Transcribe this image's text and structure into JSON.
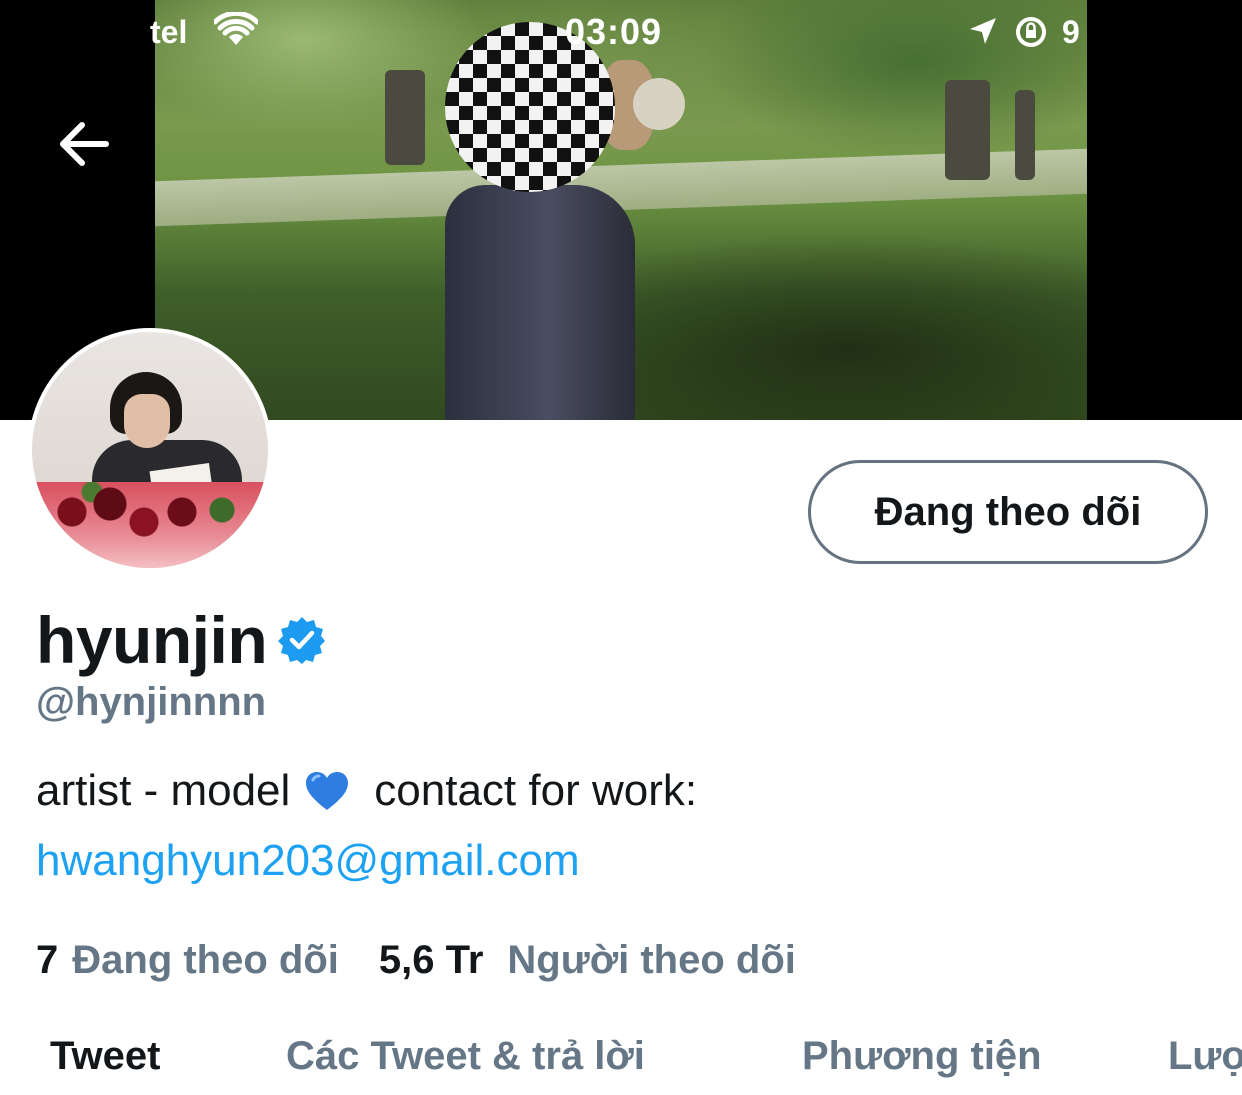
{
  "status_bar": {
    "carrier": "tel",
    "time": "03:09",
    "battery": "9"
  },
  "header": {
    "back_icon": "arrow-left-icon",
    "banner_description_icon": "banner-photo"
  },
  "profile": {
    "display_name": "hyunjin",
    "handle": "@hynjinnnn",
    "verified": true,
    "follow_button_label": "Đang theo dõi",
    "bio_text": "artist - model",
    "bio_emoji": "💙",
    "bio_text_after": "contact for work:",
    "bio_link": "hwanghyun203@gmail.com"
  },
  "stats": {
    "following_count": "7",
    "following_label": "Đang theo dõi",
    "followers_count": "5,6 Tr",
    "followers_label": "Người theo dõi"
  },
  "tabs": [
    {
      "label": "Tweet",
      "active": true
    },
    {
      "label": "Các Tweet & trả lời",
      "active": false
    },
    {
      "label": "Phương tiện",
      "active": false
    },
    {
      "label": "Lượ",
      "active": false
    }
  ],
  "colors": {
    "accent": "#1da1f2",
    "text_primary": "#14171a",
    "text_secondary": "#657786",
    "button_border": "#66737f",
    "verified": "#1d9bf0"
  }
}
